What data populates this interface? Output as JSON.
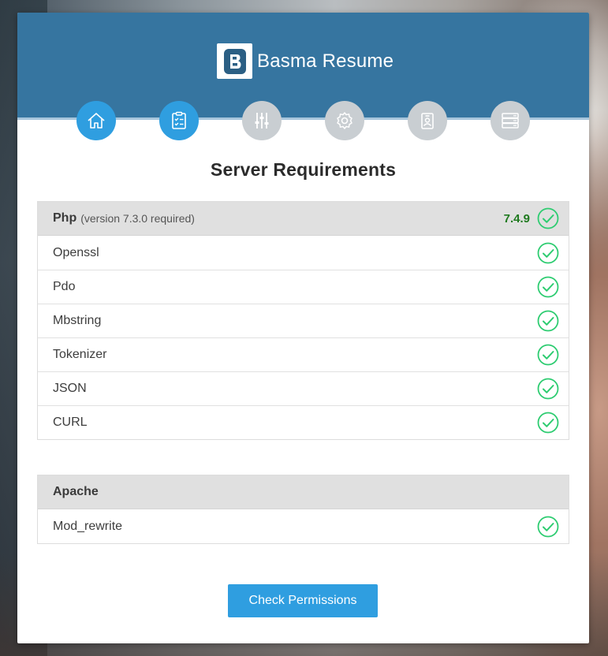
{
  "brand": {
    "name": "Basma Resume",
    "logo_letter": "B"
  },
  "steps": [
    {
      "icon": "home-icon",
      "active": true
    },
    {
      "icon": "clipboard-checklist-icon",
      "active": true
    },
    {
      "icon": "sliders-icon",
      "active": false
    },
    {
      "icon": "gear-icon",
      "active": false
    },
    {
      "icon": "id-badge-icon",
      "active": false
    },
    {
      "icon": "server-icon",
      "active": false
    }
  ],
  "page_title": "Server Requirements",
  "php_panel": {
    "name": "Php",
    "note": "(version 7.3.0 required)",
    "version": "7.4.9",
    "rows": [
      "Openssl",
      "Pdo",
      "Mbstring",
      "Tokenizer",
      "JSON",
      "CURL"
    ]
  },
  "apache_panel": {
    "name": "Apache",
    "rows": [
      "Mod_rewrite"
    ]
  },
  "check_button_label": "Check Permissions",
  "colors": {
    "header": "#3675a0",
    "accent": "#2f9ee0",
    "step_inactive": "#c9ced2",
    "success": "#2ecc71",
    "version_text": "#1f7a1f"
  }
}
